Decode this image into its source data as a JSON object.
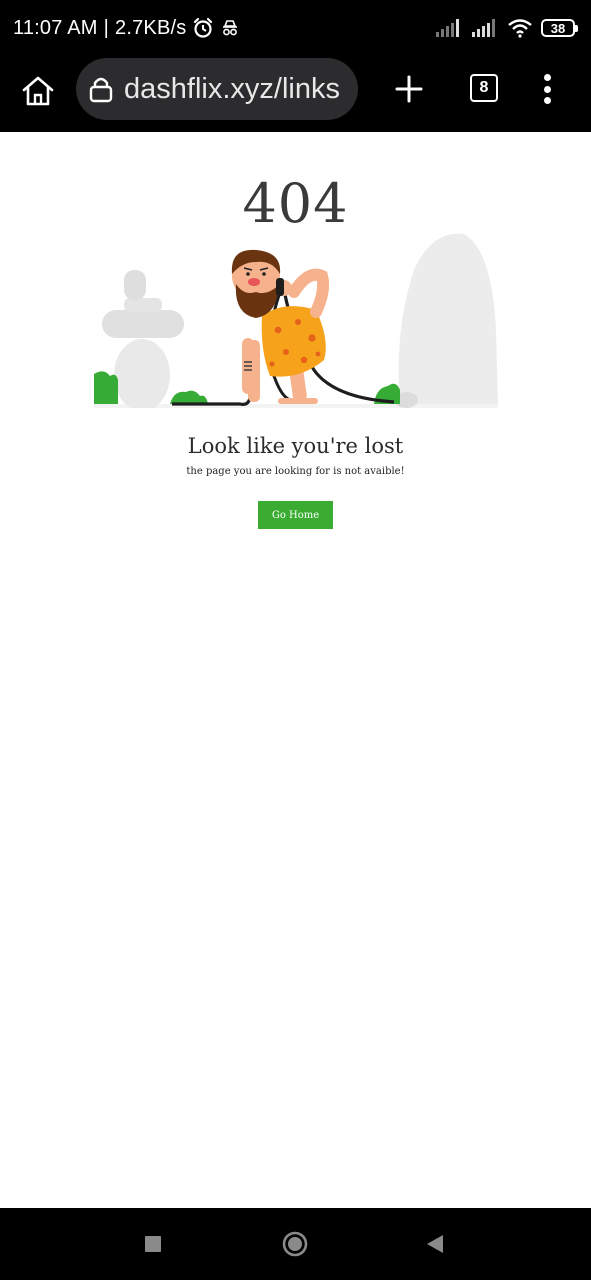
{
  "status_bar": {
    "time": "11:07 AM",
    "separator": "|",
    "speed": "2.7KB/s",
    "icons": [
      "alarm-icon",
      "incognito-icon",
      "signal-icon",
      "signal-icon",
      "wifi-icon"
    ],
    "battery": "38"
  },
  "browser": {
    "url": "dashflix.xyz/links",
    "tab_count": "8",
    "icons": [
      "home-icon",
      "lock-icon",
      "plus-icon",
      "tabs-icon",
      "more-vert-icon"
    ]
  },
  "page": {
    "error_code": "404",
    "title": "Look like you're lost",
    "subtitle": "the page you are looking for is not avaible!",
    "button_label": "Go Home",
    "accent_color": "#39ac31"
  },
  "nav": {
    "icons": [
      "recents-icon",
      "home-circle-icon",
      "back-icon"
    ]
  }
}
